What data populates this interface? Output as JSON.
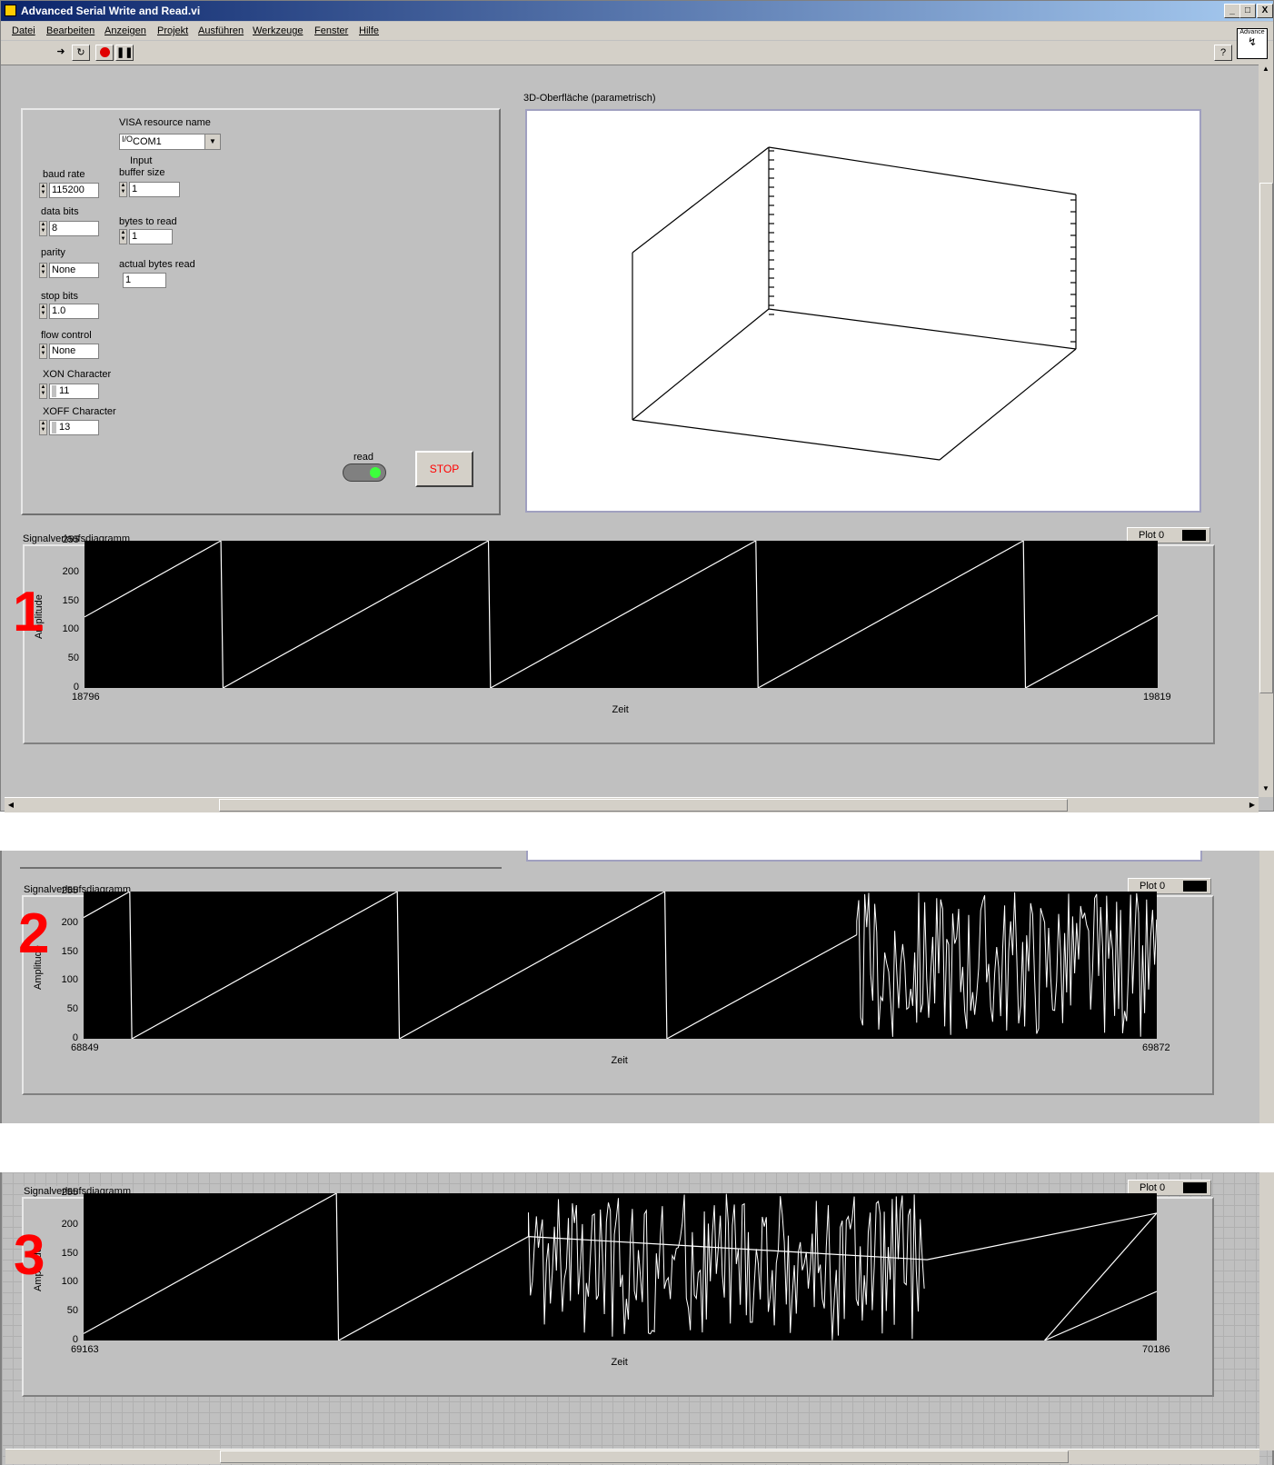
{
  "window": {
    "title": "Advanced Serial Write and Read.vi",
    "buttons": {
      "minimize": "_",
      "maximize": "□",
      "close": "X"
    }
  },
  "menu": [
    "Datei",
    "Bearbeiten",
    "Anzeigen",
    "Projekt",
    "Ausführen",
    "Werkzeuge",
    "Fenster",
    "Hilfe"
  ],
  "toolbar": {
    "icons": [
      "run-arrow-icon",
      "run-continuously-icon",
      "abort-icon",
      "pause-icon"
    ],
    "help": "?",
    "vi_icon_label": "Advance"
  },
  "controls": {
    "visa_label": "VISA resource name",
    "visa_value": "COM1",
    "baud_label": "baud rate",
    "baud_value": "115200",
    "databits_label": "data bits",
    "databits_value": "8",
    "parity_label": "parity",
    "parity_value": "None",
    "stopbits_label": "stop bits",
    "stopbits_value": "1.0",
    "flow_label": "flow control",
    "flow_value": "None",
    "xon_label": "XON Character",
    "xon_value": "11",
    "xoff_label": "XOFF Character",
    "xoff_value": "13",
    "inbuf_label_1": "Input",
    "inbuf_label_2": "buffer size",
    "inbuf_value": "1",
    "btr_label": "bytes to read",
    "btr_value": "1",
    "abr_label": "actual bytes read",
    "abr_value": "1",
    "read_label": "read",
    "stop_label": "STOP"
  },
  "surface": {
    "label": "3D-Oberfläche (parametrisch)"
  },
  "colors": {
    "title_start": "#0a246a",
    "title_end": "#a6caf0",
    "trace": "#ffffff",
    "annotation": "#ff0000",
    "stop_text": "#ff0000",
    "led": "#3cff3c"
  },
  "graphs": [
    {
      "annotation": "1",
      "label": "Signalverlaufsdiagramm",
      "legend": "Plot 0",
      "xlabel": "Zeit",
      "ylabel": "Amplitude",
      "x_start": "18796",
      "x_end": "19819",
      "yticks": [
        "255",
        "200",
        "150",
        "100",
        "50",
        "0"
      ]
    },
    {
      "annotation": "2",
      "label": "Signalverlaufsdiagramm",
      "legend": "Plot 0",
      "xlabel": "Zeit",
      "ylabel": "Amplitude",
      "x_start": "68849",
      "x_end": "69872",
      "yticks": [
        "255",
        "200",
        "150",
        "100",
        "50",
        "0"
      ]
    },
    {
      "annotation": "3",
      "label": "Signalverlaufsdiagramm",
      "legend": "Plot 0",
      "xlabel": "Zeit",
      "ylabel": "Amplitude",
      "x_start": "69163",
      "x_end": "70186",
      "yticks": [
        "255",
        "200",
        "150",
        "100",
        "50",
        "0"
      ]
    }
  ],
  "chart_data": [
    {
      "type": "line",
      "title": "Signalverlaufsdiagramm",
      "xlabel": "Zeit",
      "ylabel": "Amplitude",
      "xlim": [
        18796,
        19819
      ],
      "ylim": [
        0,
        255
      ],
      "series": [
        {
          "name": "Plot 0",
          "pattern": "sawtooth",
          "segments": [
            {
              "x": [
                18796,
                18926
              ],
              "y": [
                123,
                255
              ]
            },
            {
              "x": [
                18928,
                19181
              ],
              "y": [
                0,
                255
              ]
            },
            {
              "x": [
                19183,
                19436
              ],
              "y": [
                0,
                255
              ]
            },
            {
              "x": [
                19438,
                19691
              ],
              "y": [
                0,
                255
              ]
            },
            {
              "x": [
                19693,
                19819
              ],
              "y": [
                0,
                126
              ]
            }
          ]
        }
      ]
    },
    {
      "type": "line",
      "title": "Signalverlaufsdiagramm",
      "xlabel": "Zeit",
      "ylabel": "Amplitude",
      "xlim": [
        68849,
        69872
      ],
      "ylim": [
        0,
        255
      ],
      "series": [
        {
          "name": "Plot 0",
          "pattern": "sawtooth then noise",
          "segments": [
            {
              "x": [
                68849,
                68893
              ],
              "y": [
                210,
                255
              ]
            },
            {
              "x": [
                68895,
                69148
              ],
              "y": [
                0,
                255
              ]
            },
            {
              "x": [
                69150,
                69403
              ],
              "y": [
                0,
                255
              ]
            },
            {
              "x": [
                69405,
                69586
              ],
              "y": [
                0,
                180
              ]
            }
          ],
          "noise_range": [
            69586,
            69872
          ]
        }
      ]
    },
    {
      "type": "line",
      "title": "Signalverlaufsdiagramm",
      "xlabel": "Zeit",
      "ylabel": "Amplitude",
      "xlim": [
        69163,
        70186
      ],
      "ylim": [
        0,
        255
      ],
      "series": [
        {
          "name": "Plot 0",
          "pattern": "sawtooth, noise, sawtooth",
          "segments": [
            {
              "x": [
                69163,
                69404
              ],
              "y": [
                12,
                255
              ]
            },
            {
              "x": [
                69406,
                69587
              ],
              "y": [
                0,
                180
              ]
            },
            {
              "x": [
                69967,
                70280
              ],
              "y": [
                140,
                255
              ]
            },
            {
              "x": [
                70079,
                70186
              ],
              "y": [
                0,
                85
              ]
            }
          ],
          "noise_range": [
            69587,
            69965
          ]
        }
      ]
    }
  ]
}
